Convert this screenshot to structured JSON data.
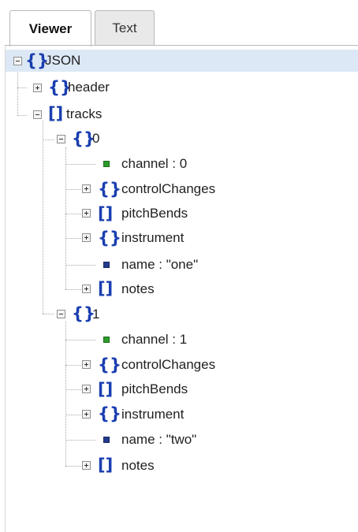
{
  "tabs": {
    "viewer": "Viewer",
    "text": "Text"
  },
  "tree": {
    "root_label": "JSON",
    "header_label": "header",
    "tracks_label": "tracks",
    "track0": {
      "label": "0",
      "channel": "channel : 0",
      "controlChanges": "controlChanges",
      "pitchBends": "pitchBends",
      "instrument": "instrument",
      "name": "name : \"one\"",
      "notes": "notes"
    },
    "track1": {
      "label": "1",
      "channel": "channel : 1",
      "controlChanges": "controlChanges",
      "pitchBends": "pitchBends",
      "instrument": "instrument",
      "name": "name : \"two\"",
      "notes": "notes"
    }
  },
  "icons": {
    "expand": "plus-box-icon",
    "collapse": "minus-box-icon",
    "object": "curly-braces-icon",
    "array": "square-brackets-icon",
    "number": "green-square-icon",
    "string": "blue-square-icon"
  },
  "colors": {
    "selection": "#dde8f6",
    "brace": "#1a3fb0",
    "number_leaf": "#2c9b2c",
    "string_leaf": "#233a8c"
  }
}
